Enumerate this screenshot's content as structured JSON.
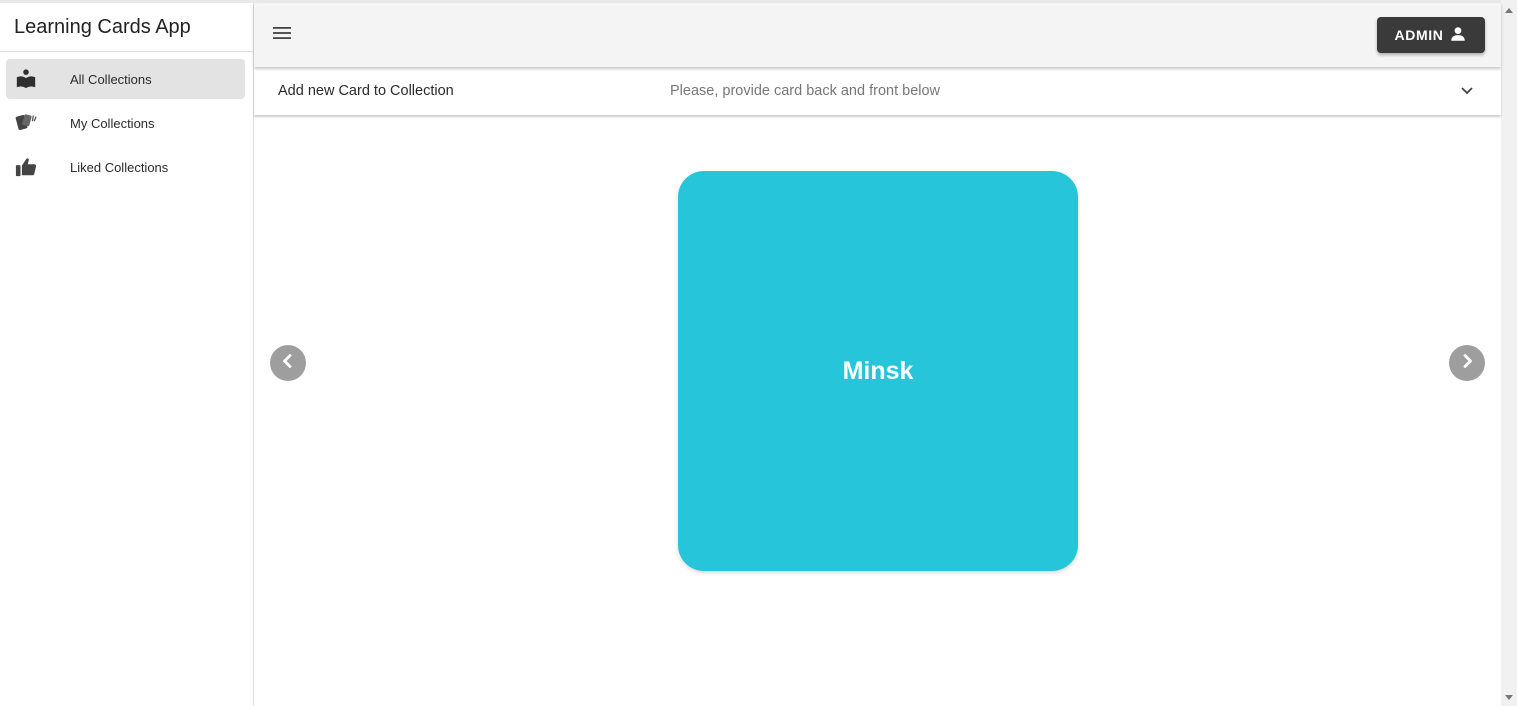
{
  "app": {
    "title": "Learning Cards App"
  },
  "sidebar": {
    "items": [
      {
        "label": "All Collections",
        "icon": "book-reader-icon",
        "active": true
      },
      {
        "label": "My Collections",
        "icon": "cards-icon",
        "active": false
      },
      {
        "label": "Liked Collections",
        "icon": "thumbs-up-icon",
        "active": false
      }
    ]
  },
  "header": {
    "user_label": "ADMIN",
    "user_icon": "person-icon",
    "menu_icon": "hamburger-icon"
  },
  "expander": {
    "title": "Add new Card to Collection",
    "subtitle": "Please, provide card back and front below"
  },
  "card": {
    "text": "Minsk",
    "color": "#26c5da"
  },
  "colors": {
    "accent": "#26c5da",
    "admin_button": "#3a3a3a",
    "appbar": "#f4f4f4",
    "nav_active": "#e3e3e3"
  }
}
